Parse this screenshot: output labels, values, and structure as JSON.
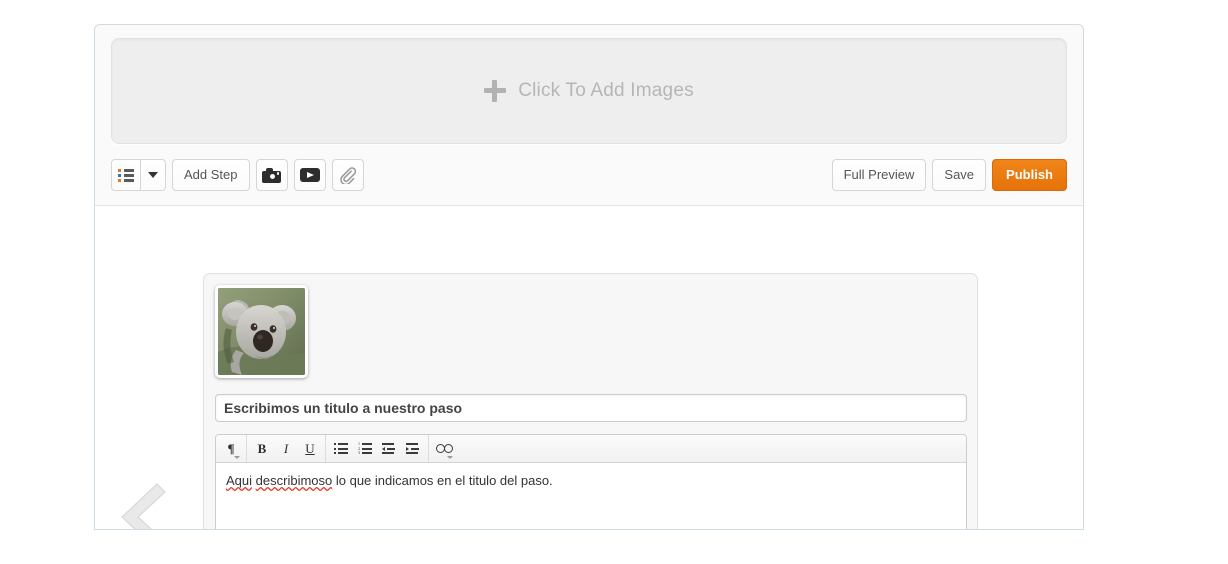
{
  "dropzone": {
    "label": "Click To Add Images",
    "plus_icon": "plus-icon"
  },
  "toolbar": {
    "left": {
      "list_icon": "list-icon",
      "dropdown_caret": "chevron-down-icon",
      "add_step_label": "Add Step",
      "camera_icon": "camera-icon",
      "video_icon": "video-icon",
      "attachment_icon": "paperclip-icon"
    },
    "right": {
      "full_preview_label": "Full Preview",
      "save_label": "Save",
      "publish_label": "Publish",
      "publish_color": "#e5730a"
    }
  },
  "navigation": {
    "prev_arrow_icon": "chevron-left-icon"
  },
  "step": {
    "thumbnail_alt": "koala-thumbnail",
    "title_value": "Escribimos un titulo a nuestro paso",
    "title_placeholder": "Step title",
    "editor": {
      "toolbar_buttons": [
        {
          "name": "paragraph-format",
          "glyph": "¶",
          "has_caret": true
        },
        {
          "name": "bold",
          "glyph": "B"
        },
        {
          "name": "italic",
          "glyph": "I"
        },
        {
          "name": "underline",
          "glyph": "U"
        },
        {
          "name": "bullet-list"
        },
        {
          "name": "numbered-list"
        },
        {
          "name": "outdent"
        },
        {
          "name": "indent"
        },
        {
          "name": "link",
          "has_caret": true
        }
      ],
      "body_text_parts": {
        "word1": "Aqui",
        "word2": "describimoso",
        "rest": " lo que indicamos en el titulo del paso."
      },
      "body_text_full": "Aqui describimoso lo que indicamos en el titulo del paso."
    }
  },
  "colors": {
    "frame_border": "#cfdbe2",
    "accent_orange": "#e5730a",
    "dropzone_bg": "#eeeeee",
    "card_bg": "#f7f7f7"
  }
}
